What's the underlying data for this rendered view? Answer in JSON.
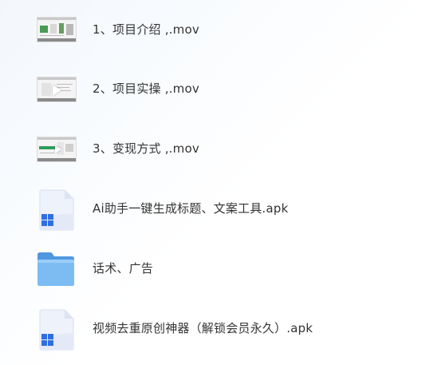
{
  "files": [
    {
      "name": "1、项目介绍 ,.mov",
      "icon": "video-thumbnail-icon"
    },
    {
      "name": "2、项目实操 ,.mov",
      "icon": "video-thumbnail-icon"
    },
    {
      "name": "3、变现方式 ,.mov",
      "icon": "video-thumbnail-icon"
    },
    {
      "name": "Ai助手一键生成标题、文案工具.apk",
      "icon": "apk-file-icon"
    },
    {
      "name": "话术、广告",
      "icon": "folder-icon"
    },
    {
      "name": "视频去重原创神器（解锁会员永久）.apk",
      "icon": "apk-file-icon"
    }
  ],
  "colors": {
    "text": "#333333",
    "folder_blue": "#5aa4e8",
    "windows_logo_blue": "#2f6fe0",
    "apk_page": "#eef2fa"
  }
}
